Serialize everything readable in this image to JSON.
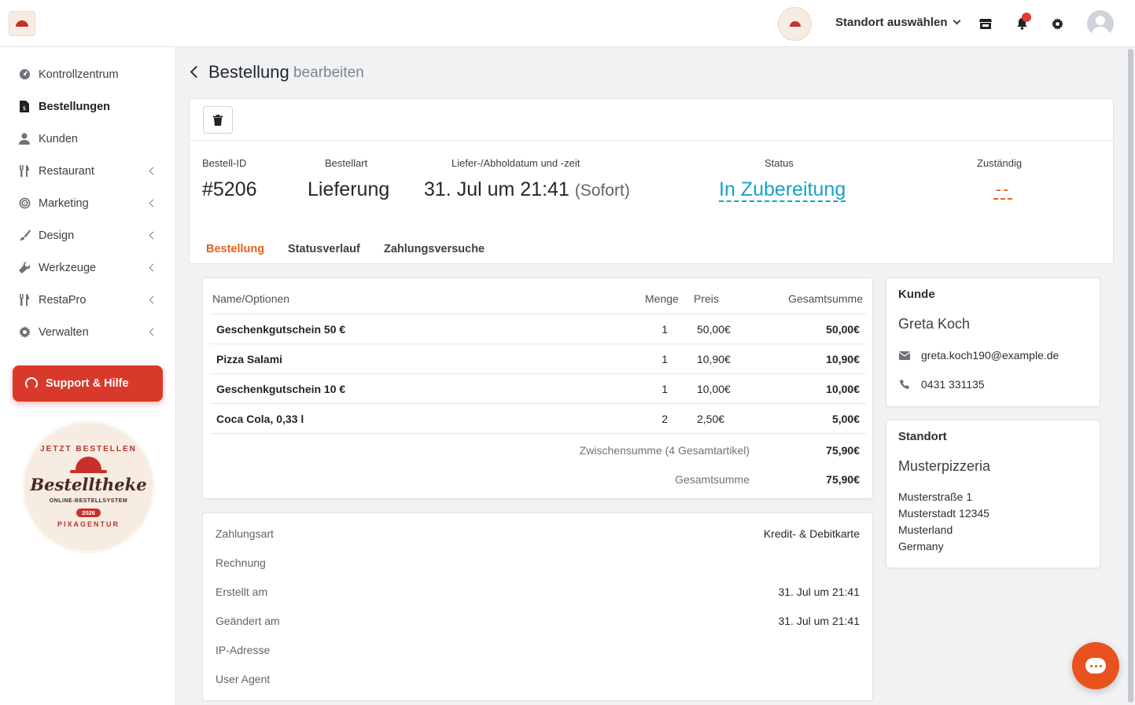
{
  "header": {
    "location_select": "Standort auswählen",
    "icons": [
      "store-icon",
      "bell-icon",
      "gear-icon",
      "user-avatar"
    ]
  },
  "sidebar": {
    "items": [
      {
        "label": "Kontrollzentrum",
        "icon": "dashboard-icon",
        "active": false,
        "expandable": false
      },
      {
        "label": "Bestellungen",
        "icon": "receipt-icon",
        "active": true,
        "expandable": false
      },
      {
        "label": "Kunden",
        "icon": "user-icon",
        "active": false,
        "expandable": false
      },
      {
        "label": "Restaurant",
        "icon": "utensils-icon",
        "active": false,
        "expandable": true
      },
      {
        "label": "Marketing",
        "icon": "target-icon",
        "active": false,
        "expandable": true
      },
      {
        "label": "Design",
        "icon": "brush-icon",
        "active": false,
        "expandable": true
      },
      {
        "label": "Werkzeuge",
        "icon": "wrench-icon",
        "active": false,
        "expandable": true
      },
      {
        "label": "RestaPro",
        "icon": "utensils-icon",
        "active": false,
        "expandable": true
      },
      {
        "label": "Verwalten",
        "icon": "gear-icon",
        "active": false,
        "expandable": true
      }
    ],
    "support_label": "Support & Hilfe",
    "badge": {
      "top": "JETZT BESTELLEN",
      "title": "Bestelltheke",
      "sub": "ONLINE-BESTELLSYSTEM",
      "year": "2026",
      "bottom": "PIXAGENTUR"
    }
  },
  "page": {
    "title": "Bestellung",
    "subtitle": "bearbeiten"
  },
  "order": {
    "labels": {
      "id": "Bestell-ID",
      "type": "Bestellart",
      "datetime": "Liefer-/Abholdatum und -zeit",
      "status": "Status",
      "assignee": "Zuständig"
    },
    "id": "#5206",
    "type": "Lieferung",
    "datetime": "31. Jul um 21:41",
    "datetime_note": "(Sofort)",
    "status": "In Zubereitung",
    "assignee": "--",
    "status_color": "#17a2c7",
    "accent_color": "#e8601c"
  },
  "tabs": [
    {
      "label": "Bestellung",
      "active": true
    },
    {
      "label": "Statusverlauf",
      "active": false
    },
    {
      "label": "Zahlungsversuche",
      "active": false
    }
  ],
  "items_table": {
    "headers": {
      "name": "Name/Optionen",
      "qty": "Menge",
      "price": "Preis",
      "total": "Gesamtsumme"
    },
    "rows": [
      {
        "name": "Geschenkgutschein 50 €",
        "qty": "1",
        "price": "50,00€",
        "total": "50,00€"
      },
      {
        "name": "Pizza Salami",
        "qty": "1",
        "price": "10,90€",
        "total": "10,90€"
      },
      {
        "name": "Geschenkgutschein 10 €",
        "qty": "1",
        "price": "10,00€",
        "total": "10,00€"
      },
      {
        "name": "Coca Cola, 0,33 l",
        "qty": "2",
        "price": "2,50€",
        "total": "5,00€"
      }
    ],
    "subtotal_label": "Zwischensumme (4 Gesamtartikel)",
    "subtotal": "75,90€",
    "grand_total_label": "Gesamtsumme",
    "grand_total": "75,90€"
  },
  "payment": {
    "rows": [
      {
        "label": "Zahlungsart",
        "value": "Kredit- & Debitkarte"
      },
      {
        "label": "Rechnung",
        "value": ""
      },
      {
        "label": "Erstellt am",
        "value": "31. Jul um 21:41"
      },
      {
        "label": "Geändert am",
        "value": "31. Jul um 21:41"
      },
      {
        "label": "IP-Adresse",
        "value": ""
      },
      {
        "label": "User Agent",
        "value": ""
      }
    ]
  },
  "customer": {
    "title": "Kunde",
    "name": "Greta Koch",
    "email": "greta.koch190@example.de",
    "phone": "0431 331135"
  },
  "location": {
    "title": "Standort",
    "name": "Musterpizzeria",
    "address": [
      "Musterstraße 1",
      "Musterstadt 12345",
      "Musterland",
      "Germany"
    ]
  }
}
